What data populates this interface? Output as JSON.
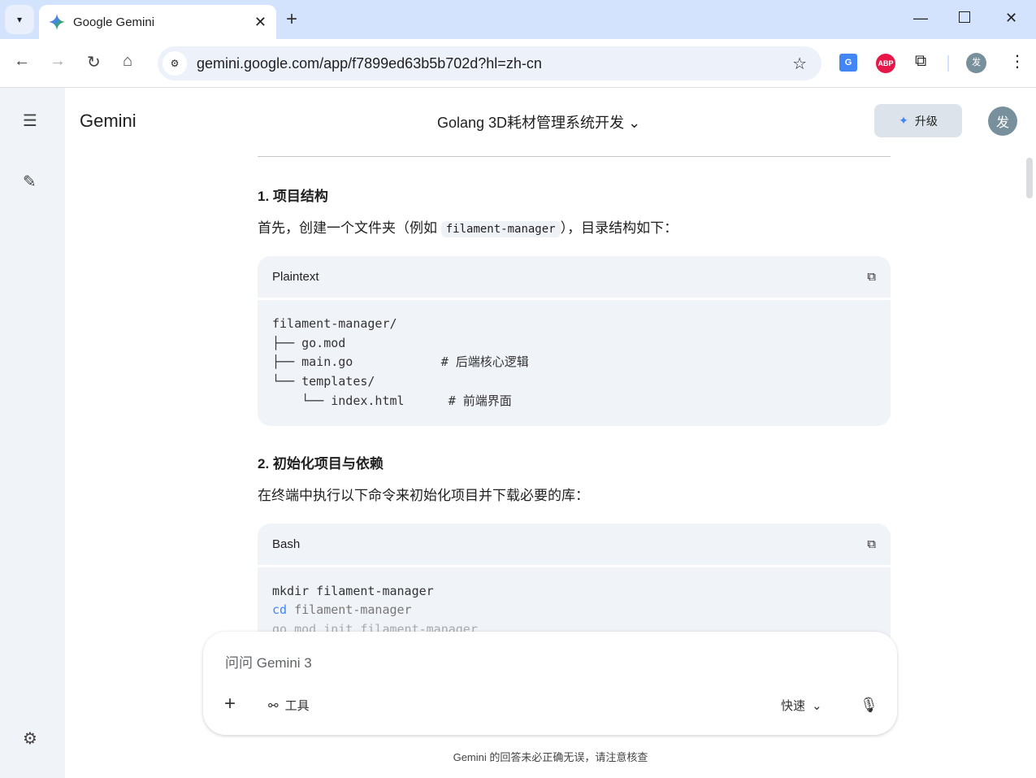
{
  "browser": {
    "tab_title": "Google Gemini",
    "url": "gemini.google.com/app/f7899ed63b5b702d?hl=zh-cn",
    "profile_initial": "发",
    "extensions": [
      "google-translate-icon",
      "adblock-plus-icon",
      "puzzle-icon"
    ]
  },
  "header": {
    "brand": "Gemini",
    "conversation_title": "Golang 3D耗材管理系统开发",
    "upgrade_label": "升级",
    "avatar_initial": "发"
  },
  "content": {
    "section1_title": "1. 项目结构",
    "section1_text_a": "首先，创建一个文件夹（例如 ",
    "section1_code": "filament-manager",
    "section1_text_b": "），目录结构如下：",
    "code1_lang": "Plaintext",
    "code1_body": "filament-manager/\n├── go.mod\n├── main.go            # 后端核心逻辑\n└── templates/\n    └── index.html      # 前端界面",
    "section2_title": "2. 初始化项目与依赖",
    "section2_text": "在终端中执行以下命令来初始化项目并下载必要的库：",
    "code2_lang": "Bash",
    "bash_line1": "mkdir filament-manager",
    "bash_kw": "cd",
    "bash_line2": " filament-manager",
    "bash_faded_line": "go mod init filament-manager"
  },
  "input": {
    "placeholder": "问问 Gemini 3",
    "tools_label": "工具",
    "mode_label": "快速"
  },
  "disclaimer": "Gemini 的回答未必正确无误，请注意核查",
  "colors": {
    "sidebar": "#f0f4f9",
    "code_bg": "#f0f4f9",
    "tabbar": "#d3e3fd",
    "keyword": "#4285f4"
  }
}
